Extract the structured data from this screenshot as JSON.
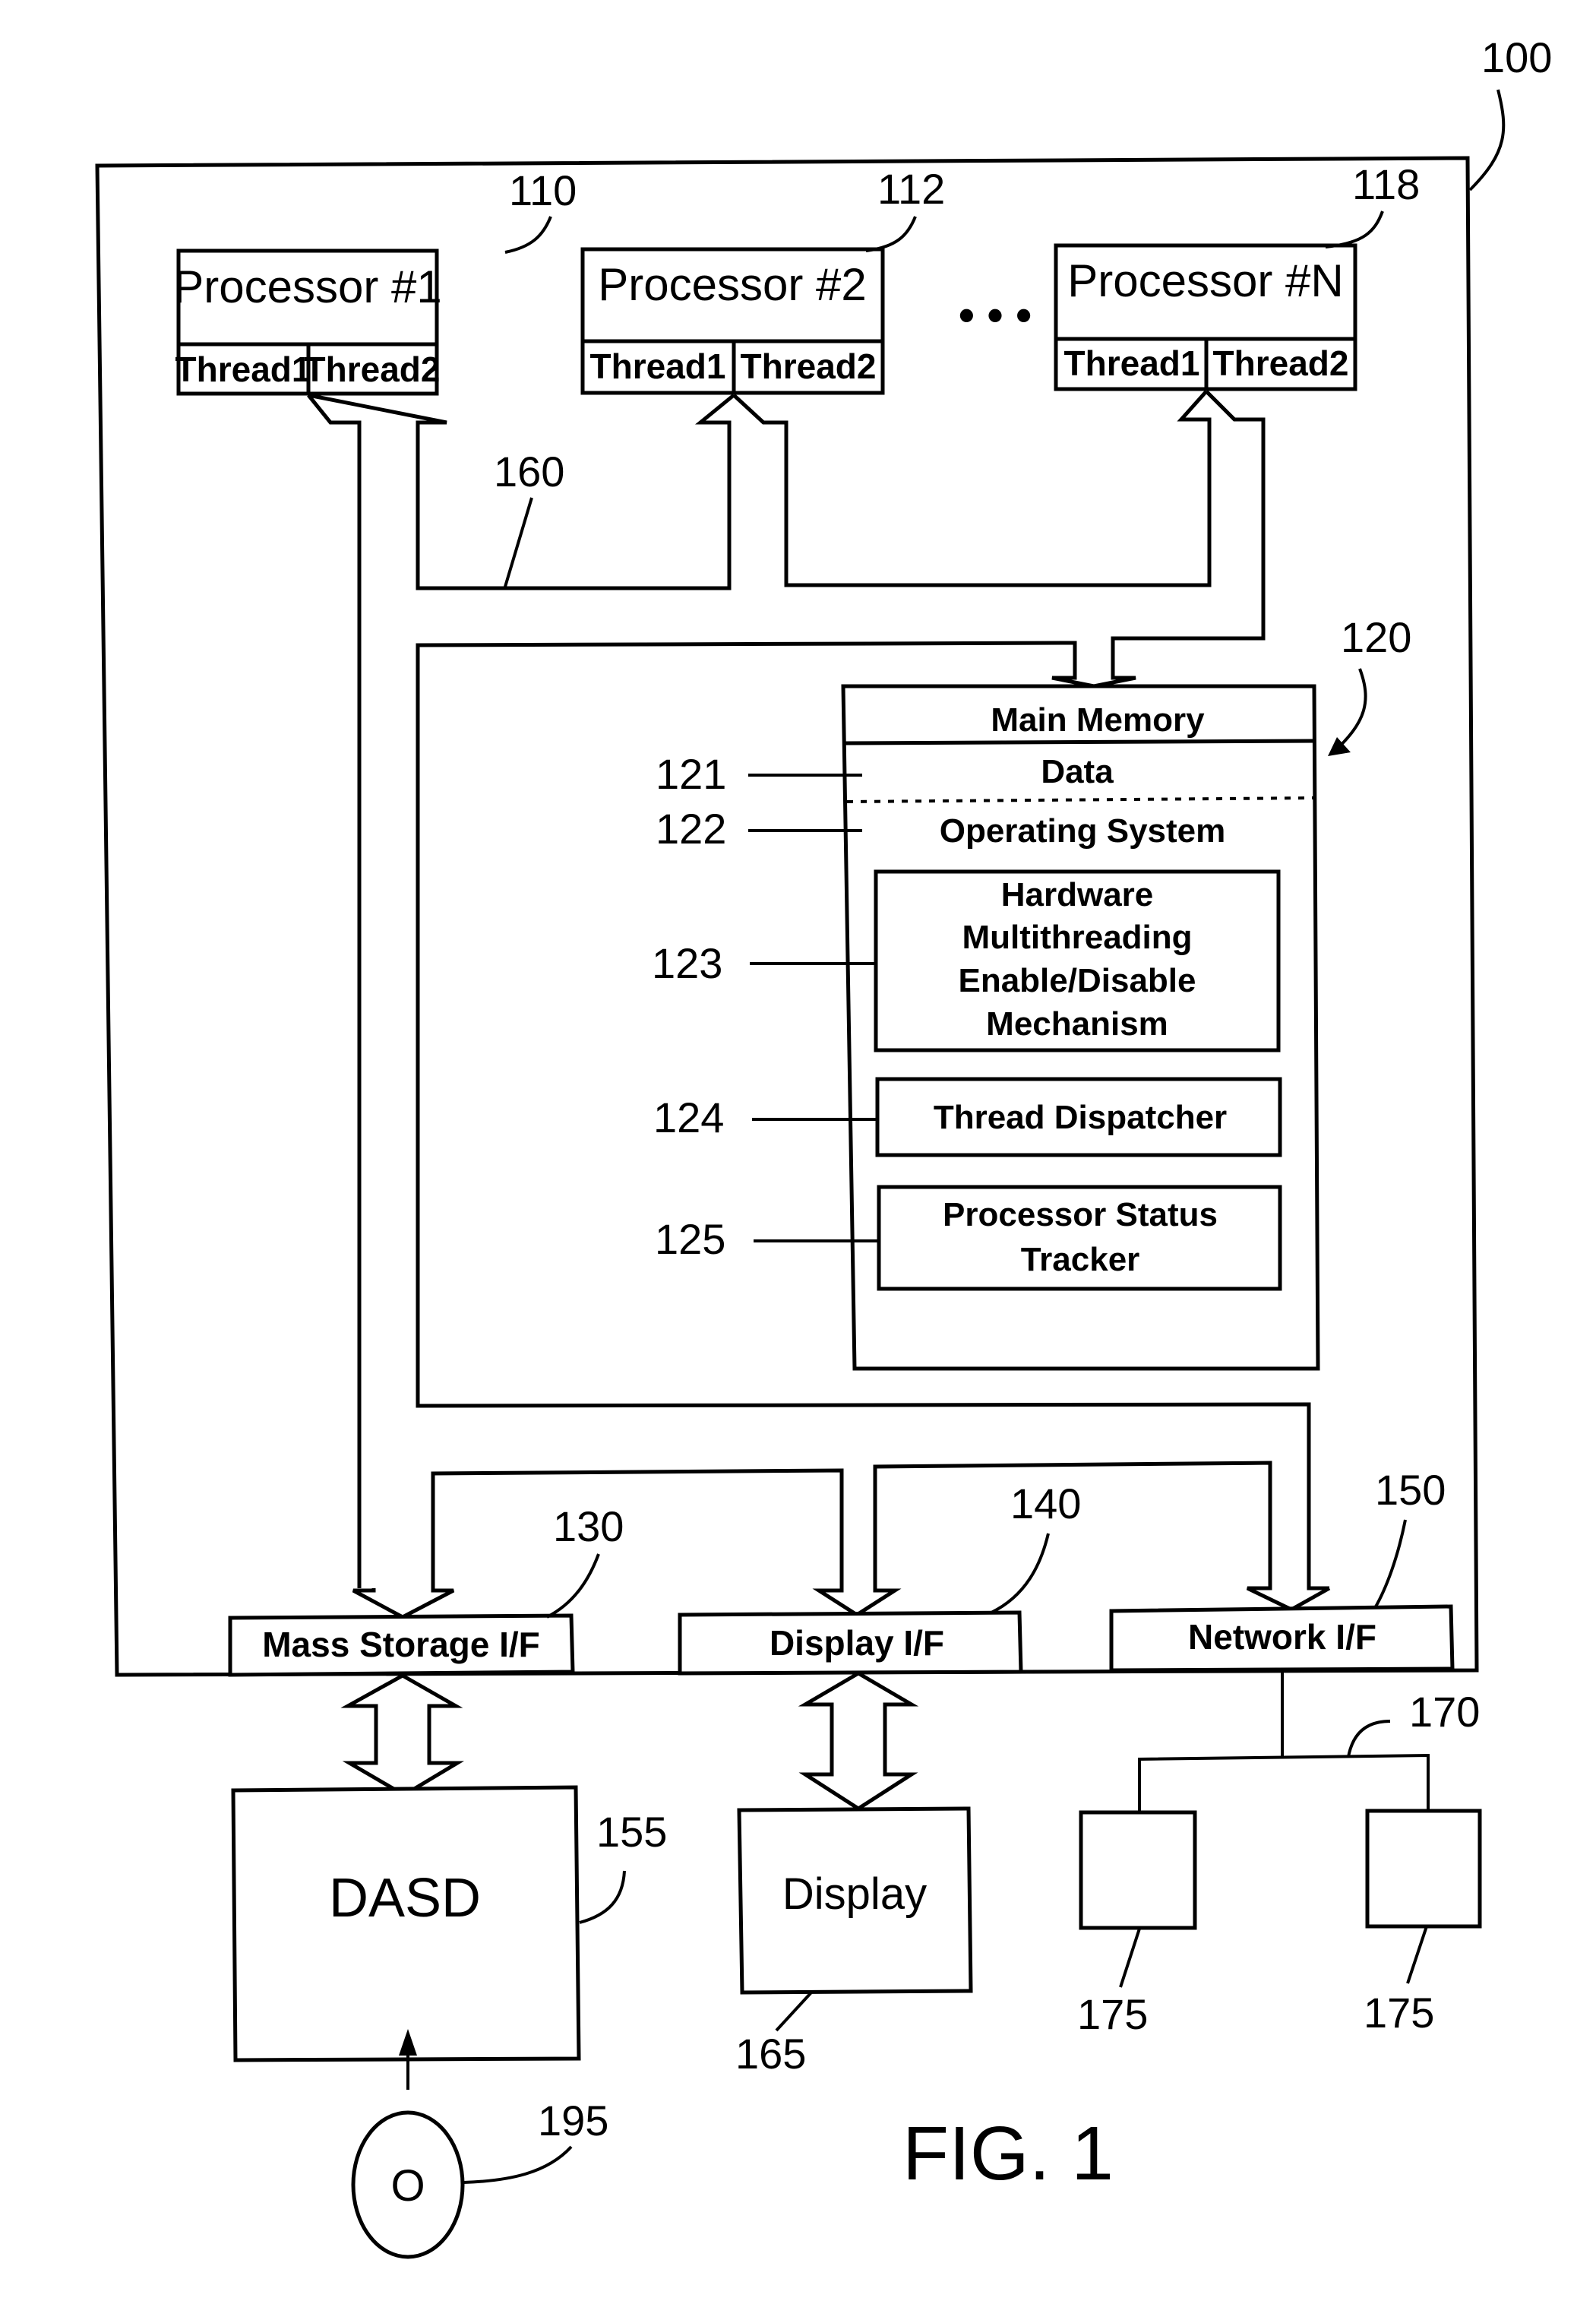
{
  "figure": {
    "title": "FIG. 1",
    "system_ref": "100"
  },
  "processors": [
    {
      "ref": "110",
      "label": "Processor #1",
      "threads": [
        "Thread1",
        "Thread2"
      ]
    },
    {
      "ref": "112",
      "label": "Processor #2",
      "threads": [
        "Thread1",
        "Thread2"
      ]
    },
    {
      "ref": "118",
      "label": "Processor #N",
      "threads": [
        "Thread1",
        "Thread2"
      ]
    }
  ],
  "ellipsis": "• • •",
  "bus": {
    "ref": "160"
  },
  "main_memory": {
    "ref": "120",
    "title": "Main Memory",
    "sections": [
      {
        "ref": "121",
        "label": "Data"
      },
      {
        "ref": "122",
        "label": "Operating System"
      }
    ],
    "components": [
      {
        "ref": "123",
        "lines": [
          "Hardware",
          "Multithreading",
          "Enable/Disable",
          "Mechanism"
        ]
      },
      {
        "ref": "124",
        "lines": [
          "Thread Dispatcher"
        ]
      },
      {
        "ref": "125",
        "lines": [
          "Processor Status",
          "Tracker"
        ]
      }
    ]
  },
  "interfaces": [
    {
      "ref": "130",
      "label": "Mass Storage I/F"
    },
    {
      "ref": "140",
      "label": "Display I/F"
    },
    {
      "ref": "150",
      "label": "Network I/F"
    }
  ],
  "devices": {
    "dasd": {
      "ref": "155",
      "label": "DASD"
    },
    "display": {
      "ref": "165",
      "label": "Display"
    },
    "network": {
      "ref": "170"
    },
    "network_nodes": [
      {
        "ref": "175"
      },
      {
        "ref": "175"
      }
    ],
    "media": {
      "ref": "195",
      "label": "O"
    }
  }
}
